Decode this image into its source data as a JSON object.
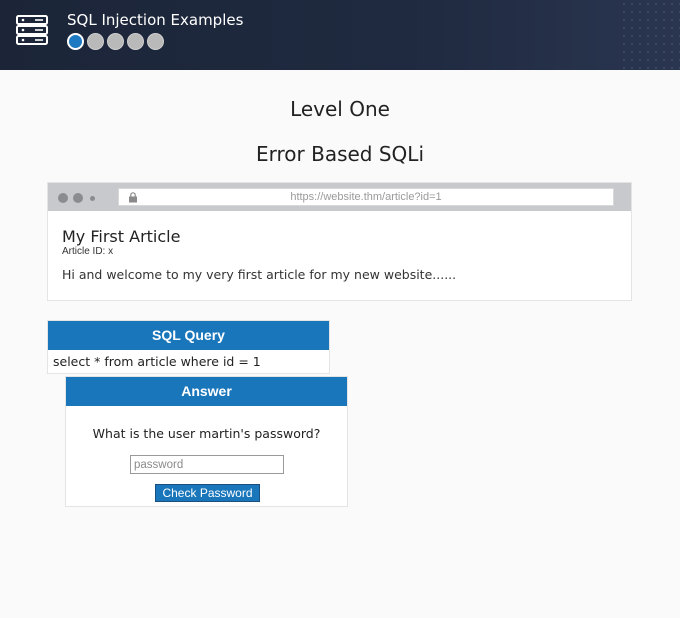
{
  "header": {
    "title": "SQL Injection Examples",
    "icon": "server-icon",
    "progress": {
      "total": 5,
      "current": 1
    },
    "colors": {
      "active_step": "#1d79c2",
      "inactive_step": "#b9b9b9"
    }
  },
  "level": {
    "title": "Level One",
    "subtitle": "Error Based SQLi"
  },
  "browser": {
    "url": "https://website.thm/article?id=1",
    "article": {
      "title": "My First Article",
      "id_label": "Article ID: x",
      "body": "Hi and welcome to my very first article for my new website......"
    }
  },
  "sql_query": {
    "header": "SQL Query",
    "query": "select * from article where id = 1"
  },
  "answer": {
    "header": "Answer",
    "question": "What is the user martin's password?",
    "input_placeholder": "password",
    "input_value": "",
    "button_label": "Check Password"
  },
  "colors": {
    "accent": "#1a76bb",
    "topbar": "#1f2a40"
  }
}
